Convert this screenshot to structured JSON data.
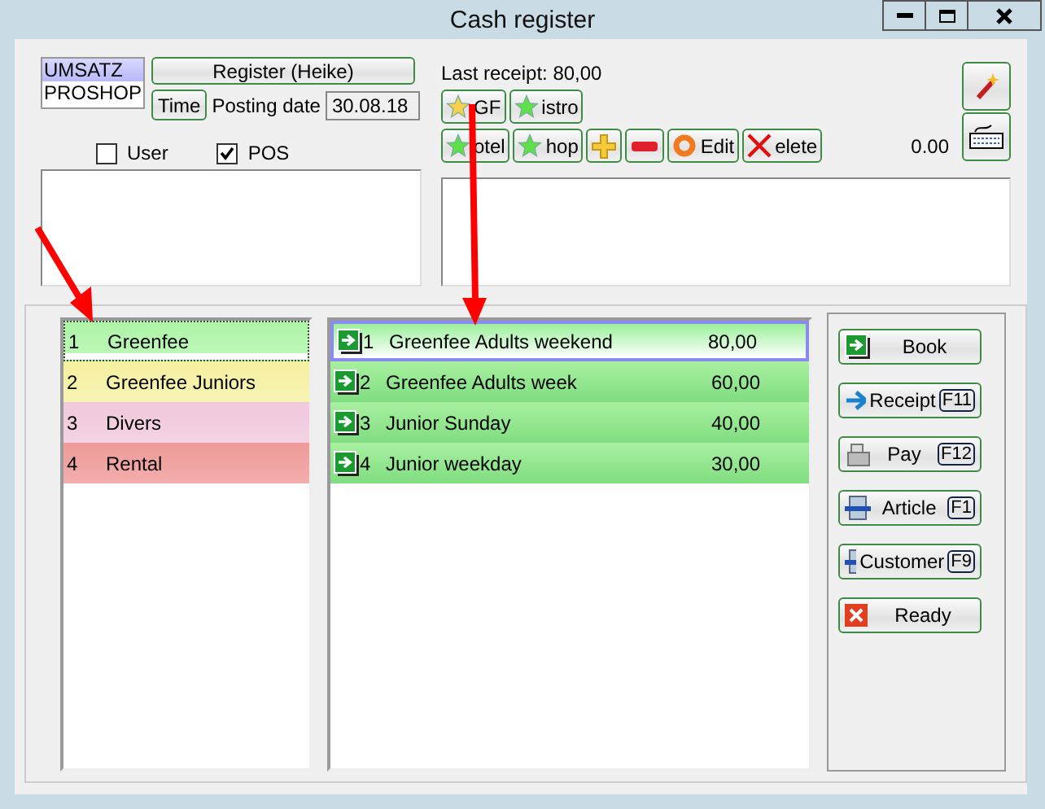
{
  "window": {
    "title": "Cash register"
  },
  "registers": [
    {
      "label": "UMSATZ",
      "selected": true
    },
    {
      "label": "PROSHOP",
      "selected": false
    }
  ],
  "register_button": "Register (Heike)",
  "time_button": "Time",
  "posting_date": {
    "label": "Posting date",
    "value": "30.08.18"
  },
  "filters": [
    {
      "label": "User",
      "checked": false
    },
    {
      "label": "POS",
      "checked": true
    }
  ],
  "last_receipt": "Last receipt: 80,00",
  "toolbar_rows": [
    [
      {
        "kind": "star-gold",
        "label": "GF"
      },
      {
        "kind": "star-green",
        "label": "istro"
      }
    ],
    [
      {
        "kind": "star-green",
        "label": "otel"
      },
      {
        "kind": "star-green",
        "label": "hop"
      },
      {
        "kind": "plus"
      },
      {
        "kind": "minus"
      },
      {
        "kind": "ring",
        "label": "Edit"
      },
      {
        "kind": "cross",
        "label": "elete"
      }
    ]
  ],
  "total": "0.00",
  "categories": [
    {
      "number": "1",
      "name": "Greenfee",
      "color": "#aef5a8",
      "selected": true
    },
    {
      "number": "2",
      "name": "Greenfee Juniors",
      "color": "#f5f0a0",
      "selected": false
    },
    {
      "number": "3",
      "name": "Divers",
      "color": "#f0c8dc",
      "selected": false
    },
    {
      "number": "4",
      "name": "Rental",
      "color": "#ef9a98",
      "selected": false
    }
  ],
  "articles": [
    {
      "number": "1",
      "name": "Greenfee Adults weekend",
      "price": "80,00",
      "selected": true
    },
    {
      "number": "2",
      "name": "Greenfee Adults week",
      "price": "60,00",
      "selected": false
    },
    {
      "number": "3",
      "name": "Junior Sunday",
      "price": "40,00",
      "selected": false
    },
    {
      "number": "4",
      "name": "Junior weekday",
      "price": "30,00",
      "selected": false
    }
  ],
  "actions": [
    {
      "kind": "book",
      "label": "Book"
    },
    {
      "kind": "arrow",
      "label": "Receipt",
      "key": "F11"
    },
    {
      "kind": "register",
      "label": "Pay",
      "key": "F12"
    },
    {
      "kind": "printer",
      "label": "Article",
      "key": "F1"
    },
    {
      "kind": "printer",
      "label": "Customer",
      "key": "F9"
    },
    {
      "kind": "close",
      "label": "Ready"
    }
  ]
}
